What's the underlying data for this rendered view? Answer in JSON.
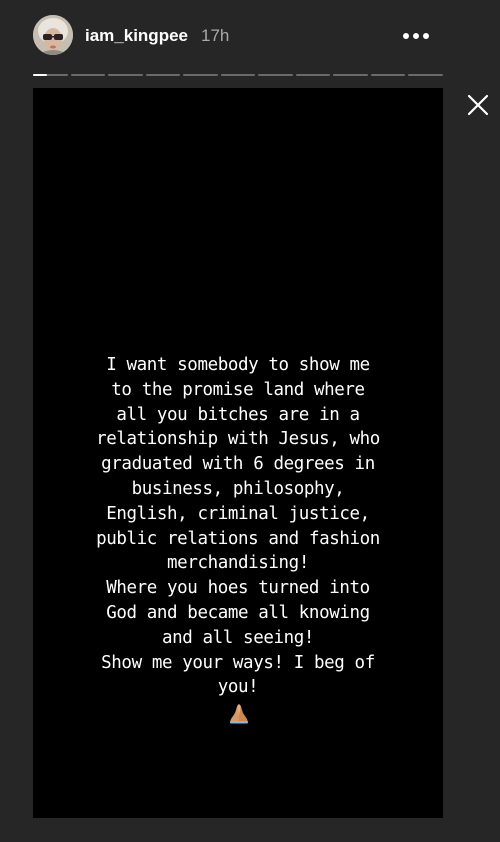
{
  "header": {
    "username": "iam_kingpee",
    "timestamp": "17h",
    "more_icon": "more-horizontal-icon"
  },
  "progress": {
    "segments": [
      {
        "fill": 0.4
      },
      {
        "fill": 0
      },
      {
        "fill": 0
      },
      {
        "fill": 0
      },
      {
        "fill": 0
      },
      {
        "fill": 0
      },
      {
        "fill": 0
      },
      {
        "fill": 0
      },
      {
        "fill": 0
      },
      {
        "fill": 0
      },
      {
        "fill": 0
      }
    ]
  },
  "close_icon": "close-icon",
  "story": {
    "background": "#000000",
    "text_lines": [
      "I want somebody to show me",
      "to the promise land where",
      "all you bitches are in a",
      "relationship with Jesus, who",
      "graduated with 6 degrees in",
      "business, philosophy,",
      "English, criminal justice,",
      "public relations and fashion",
      "merchandising!",
      "Where you hoes turned into",
      "God and became all knowing",
      "and all seeing!",
      "Show me your ways! I beg of",
      "you!"
    ],
    "emoji": "praying-hands-icon"
  },
  "colors": {
    "page_background": "#262626",
    "timestamp": "#a9a9a9",
    "progress_track": "#6a6a6a",
    "progress_fill": "#ffffff"
  }
}
